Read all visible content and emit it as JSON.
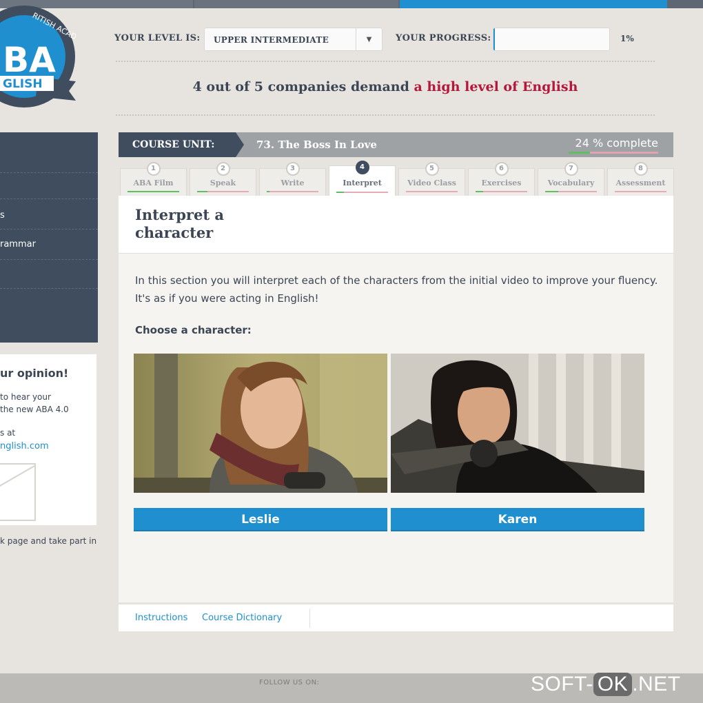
{
  "logo": {
    "line1": "BA",
    "line2": "GLISH",
    "ring_text": "RITISH ACADEMY"
  },
  "level": {
    "label": "YOUR LEVEL IS:",
    "value": "UPPER INTERMEDIATE"
  },
  "progress": {
    "label": "YOUR PROGRESS:",
    "percent_text": "1%",
    "value": 0.01
  },
  "headline": {
    "part1": "4 out of 5 companies demand ",
    "accent": "a high level of English"
  },
  "sidebar": {
    "items": [
      {
        "label": "s"
      },
      {
        "label": "rammar"
      }
    ],
    "opinion": {
      "title": "ur opinion!",
      "line1": " to hear your",
      "line2": "the new ABA 4.0",
      "line3": "s at",
      "email": "nglish.com"
    },
    "footer_text": "k page and take part in"
  },
  "course": {
    "label": "COURSE UNIT:",
    "title": "73. The Boss In Love",
    "complete_text": "24 % complete",
    "complete_value": 0.24
  },
  "tabs": [
    {
      "num": "1",
      "label": "ABA Film",
      "progress": 1.0
    },
    {
      "num": "2",
      "label": "Speak",
      "progress": 0.2
    },
    {
      "num": "3",
      "label": "Write",
      "progress": 0.05
    },
    {
      "num": "4",
      "label": "Interpret",
      "progress": 0.15,
      "active": true
    },
    {
      "num": "5",
      "label": "Video Class",
      "progress": 0.0
    },
    {
      "num": "6",
      "label": "Exercises",
      "progress": 0.15
    },
    {
      "num": "7",
      "label": "Vocabulary",
      "progress": 0.25
    },
    {
      "num": "8",
      "label": "Assessment",
      "progress": 0.0
    }
  ],
  "section": {
    "title": "Interpret a character",
    "description": "In this section you will interpret each of the characters from the initial video to improve your fluency. It's as if you were acting in English!",
    "choose": "Choose a character:"
  },
  "characters": [
    {
      "name": "Leslie"
    },
    {
      "name": "Karen"
    }
  ],
  "footer": {
    "instructions": "Instructions",
    "dictionary": "Course Dictionary"
  },
  "bottom": {
    "follow": "FOLLOW US ON:"
  },
  "watermark": {
    "left": "SOFT-",
    "ok": "OK",
    "right": ".NET"
  },
  "colors": {
    "accent": "#1f8fcf",
    "brand_dark": "#3f4d5e",
    "headline_red": "#b3183a",
    "progress_green": "#5fbf5f"
  }
}
